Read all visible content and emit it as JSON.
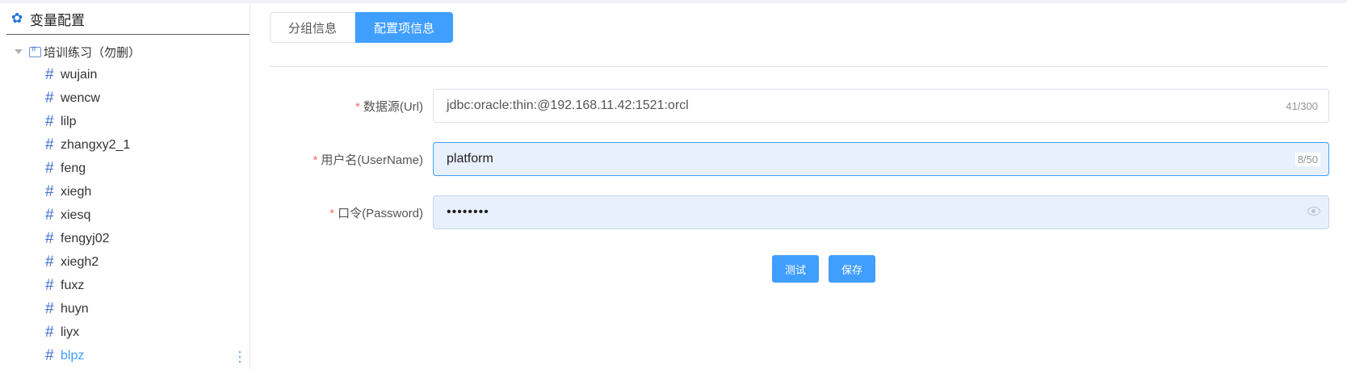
{
  "sidebar": {
    "title": "变量配置",
    "header_icon": "gear-icon",
    "root": {
      "label": "培训练习（勿删）",
      "expanded": true
    },
    "items": [
      {
        "label": "wujain"
      },
      {
        "label": "wencw"
      },
      {
        "label": "lilp"
      },
      {
        "label": "zhangxy2_1"
      },
      {
        "label": "feng"
      },
      {
        "label": "xiegh"
      },
      {
        "label": "xiesq"
      },
      {
        "label": "fengyj02"
      },
      {
        "label": "xiegh2"
      },
      {
        "label": "fuxz"
      },
      {
        "label": "huyn"
      },
      {
        "label": "liyx"
      },
      {
        "label": "blpz",
        "active": true
      }
    ],
    "item_icon": "hash-icon",
    "hash_glyph": "#"
  },
  "tabs": [
    {
      "label": "分组信息",
      "active": false
    },
    {
      "label": "配置项信息",
      "active": true
    }
  ],
  "form": {
    "required_mark": "*",
    "url": {
      "label": "数据源(Url)",
      "value": "jdbc:oracle:thin:@192.168.11.42:1521:orcl",
      "count": "41/300"
    },
    "username": {
      "label": "用户名(UserName)",
      "value": "platform",
      "count": "8/50"
    },
    "password": {
      "label": "口令(Password)",
      "value": "••••••••"
    }
  },
  "actions": {
    "test_label": "测试",
    "save_label": "保存"
  },
  "colors": {
    "accent": "#409eff",
    "required": "#f56c6c",
    "autofill_bg": "#e8f0fe"
  }
}
